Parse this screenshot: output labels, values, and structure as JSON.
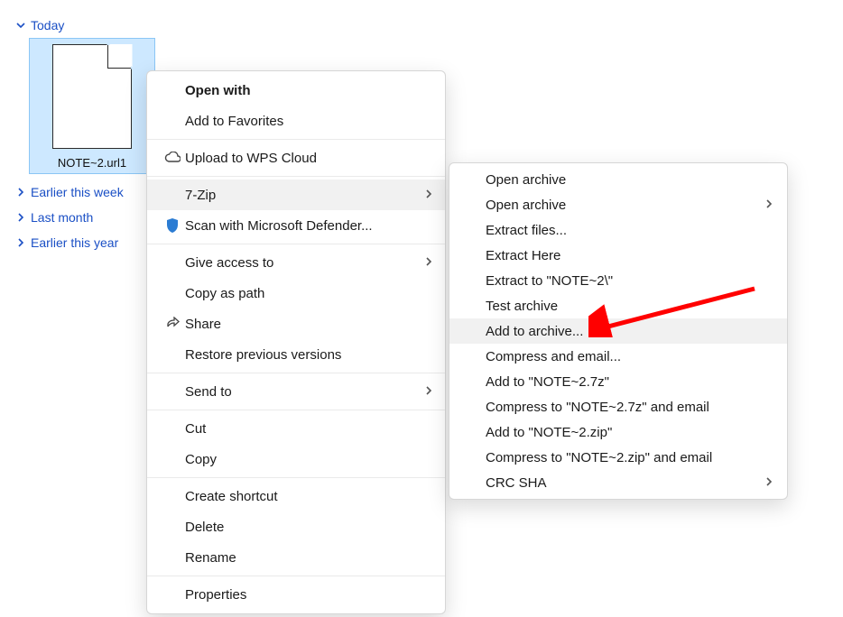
{
  "groups": [
    {
      "label": "Today",
      "expanded": true
    },
    {
      "label": "Earlier this week",
      "expanded": false
    },
    {
      "label": "Last month",
      "expanded": false
    },
    {
      "label": "Earlier this year",
      "expanded": false
    }
  ],
  "file": {
    "name": "NOTE~2.url1"
  },
  "context_menu": {
    "open_with": "Open with",
    "add_favorites": "Add to Favorites",
    "upload_wps": "Upload to WPS Cloud",
    "seven_zip": "7-Zip",
    "scan_defender": "Scan with Microsoft Defender...",
    "give_access": "Give access to",
    "copy_path": "Copy as path",
    "share": "Share",
    "restore_prev": "Restore previous versions",
    "send_to": "Send to",
    "cut": "Cut",
    "copy": "Copy",
    "create_shortcut": "Create shortcut",
    "delete": "Delete",
    "rename": "Rename",
    "properties": "Properties"
  },
  "submenu_7zip": {
    "open_archive1": "Open archive",
    "open_archive2": "Open archive",
    "extract_files": "Extract files...",
    "extract_here": "Extract Here",
    "extract_to": "Extract to \"NOTE~2\\\"",
    "test_archive": "Test archive",
    "add_to_archive": "Add to archive...",
    "compress_email": "Compress and email...",
    "add_to_7z": "Add to \"NOTE~2.7z\"",
    "compress_7z_email": "Compress to \"NOTE~2.7z\" and email",
    "add_to_zip": "Add to \"NOTE~2.zip\"",
    "compress_zip_email": "Compress to \"NOTE~2.zip\" and email",
    "crc_sha": "CRC SHA"
  }
}
